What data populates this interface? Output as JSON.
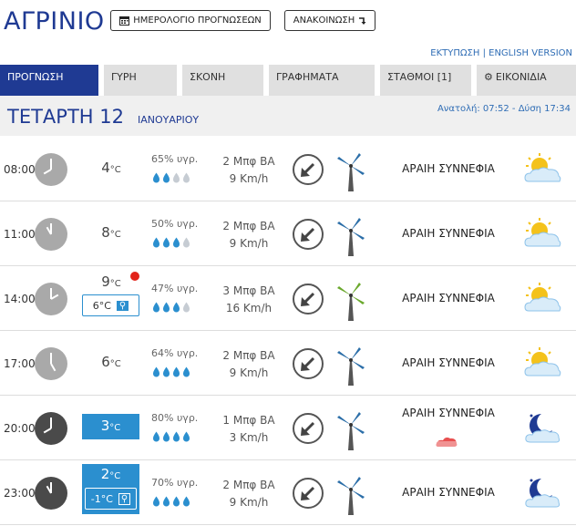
{
  "header": {
    "city": "ΑΓΡΙΝΙΟ",
    "calendar_button": "ΗΜΕΡΟΛΟΓΙΟ ΠΡΟΓΝΩΣΕΩΝ",
    "announcement_button": "ΑΝΑΚΟΙΝΩΣΗ",
    "print_link": "ΕΚΤΥΠΩΣΗ",
    "separator": " | ",
    "english_link": "ENGLISH VERSION"
  },
  "tabs": [
    {
      "label": "ΠΡΟΓΝΩΣΗ",
      "active": true
    },
    {
      "label": "ΓΥΡΗ"
    },
    {
      "label": "ΣΚΟΝΗ"
    },
    {
      "label": "ΓΡΑΦΗΜΑΤΑ"
    },
    {
      "label": "ΣΤΑΘΜΟΙ  [1]"
    },
    {
      "label": "ΕΙΚΟΝΙΔΙΑ"
    }
  ],
  "date": {
    "day": "ΤΕΤΑΡΤΗ 12",
    "month": "ΙΑΝΟΥΑΡΙΟΥ",
    "sun": "Ανατολή: 07:52  - Δύση 17:34"
  },
  "colors": {
    "brand": "#1f3a93",
    "highlight": "#2b8fcf",
    "alert": "#e2231a"
  },
  "forecast": [
    {
      "time": "08:00",
      "temp": "4",
      "unit": "°C",
      "humidity": "65% υγρ.",
      "drops": 1,
      "beaufort": "2 Μπφ ΒΑ",
      "speed": "9 Km/h",
      "condition": "ΑΡΑΙΗ ΣΥΝΝΕΦΙΑ",
      "night": false,
      "icon": "sun-cloud-icon"
    },
    {
      "time": "11:00",
      "temp": "8",
      "unit": "°C",
      "humidity": "50% υγρ.",
      "drops": 2,
      "beaufort": "2 Μπφ ΒΑ",
      "speed": "9 Km/h",
      "condition": "ΑΡΑΙΗ ΣΥΝΝΕΦΙΑ",
      "night": false,
      "icon": "sun-cloud-icon"
    },
    {
      "time": "14:00",
      "temp": "9",
      "unit": "°C",
      "feels": "6°C",
      "humidity": "47% υγρ.",
      "drops": 2,
      "beaufort": "3 Μπφ ΒΑ",
      "speed": "16 Km/h",
      "condition": "ΑΡΑΙΗ ΣΥΝΝΕΦΙΑ",
      "night": false,
      "icon": "sun-cloud-icon",
      "alert": true
    },
    {
      "time": "17:00",
      "temp": "6",
      "unit": "°C",
      "humidity": "64% υγρ.",
      "drops": 3,
      "beaufort": "2 Μπφ ΒΑ",
      "speed": "9 Km/h",
      "condition": "ΑΡΑΙΗ ΣΥΝΝΕΦΙΑ",
      "night": false,
      "icon": "sun-cloud-icon"
    },
    {
      "time": "20:00",
      "temp": "3",
      "unit": "°C",
      "humidity": "80% υγρ.",
      "drops": 3,
      "beaufort": "1 Μπφ ΒΑ",
      "speed": "3 Km/h",
      "condition": "ΑΡΑΙΗ ΣΥΝΝΕΦΙΑ",
      "night": true,
      "icon": "moon-cloud-icon",
      "highlight": true,
      "rain": true
    },
    {
      "time": "23:00",
      "temp": "2",
      "unit": "°C",
      "feels": "-1°C",
      "humidity": "70% υγρ.",
      "drops": 3,
      "beaufort": "2 Μπφ ΒΑ",
      "speed": "9 Km/h",
      "condition": "ΑΡΑΙΗ ΣΥΝΝΕΦΙΑ",
      "night": true,
      "icon": "moon-cloud-icon",
      "highlight": true
    }
  ]
}
